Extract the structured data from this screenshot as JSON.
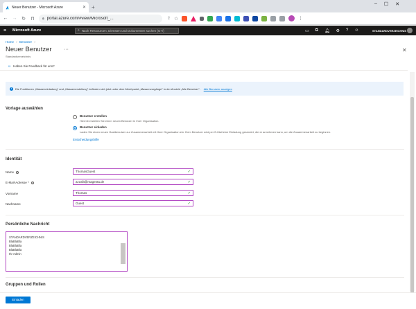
{
  "browser": {
    "tab_title": "Neuer Benutzer - Microsoft Azure",
    "url": "portal.azure.com/#view/Microsoft_..."
  },
  "azure": {
    "brand": "Microsoft Azure",
    "search_placeholder": "Nach Ressourcen, Diensten und Dokumenten suchen (G+/)",
    "directory": "STANDARDVERZEICHNIS"
  },
  "breadcrumb": [
    "Home",
    "Benutzer"
  ],
  "blade": {
    "title": "Neuer Benutzer",
    "subtitle": "Standardverzeichnis",
    "feedback": "Haben Sie Feedback für uns?"
  },
  "banner": {
    "text": "Die Funktionen „Masseneinladung\" und „Massenerstellung\" befinden sich jetzt unter dem Menüpunkt „Massenvorgänge\" in der Ansicht „Alle Benutzer\".",
    "link": "Alle Benutzer anzeigen"
  },
  "template": {
    "heading": "Vorlage auswählen",
    "options": [
      {
        "label": "Benutzer erstellen",
        "desc": "Hiermit erstellen Sie einen neuen Benutzer in Ihrer Organisation.",
        "selected": false
      },
      {
        "label": "Benutzer einladen",
        "desc": "Laden Sie einen neuen Gastbenutzer zur Zusammenarbeit mit Ihrer Organisation ein. Dem Benutzer wird per E-Mail eine Einladung gesendet, die er annehmen kann, um die Zusammenarbeit zu beginnen.",
        "selected": true
      }
    ],
    "help_link": "Entscheidungshilfe"
  },
  "identity": {
    "heading": "Identität",
    "fields": [
      {
        "label": "Name",
        "value": "ThomasGuest"
      },
      {
        "label": "E-Mail-Adresse *",
        "value": "azuslit@magenta.de"
      },
      {
        "label": "Vorname",
        "value": "Thomas"
      },
      {
        "label": "Nachname",
        "value": "Guest"
      }
    ]
  },
  "message": {
    "heading": "Persönliche Nachricht",
    "lines": [
      "STANDARDVERZEICHNIS",
      "",
      "BlaBlaBla",
      "BlaBlaBla",
      "BlaBlaBla",
      "",
      "Ihr Admin"
    ]
  },
  "groups": {
    "heading": "Gruppen und Rollen"
  },
  "footer": {
    "invite_button": "Einladen"
  },
  "colors": {
    "accent": "#0078d4",
    "field_border": "#b146c2",
    "azure_bar": "#1b1a19"
  }
}
